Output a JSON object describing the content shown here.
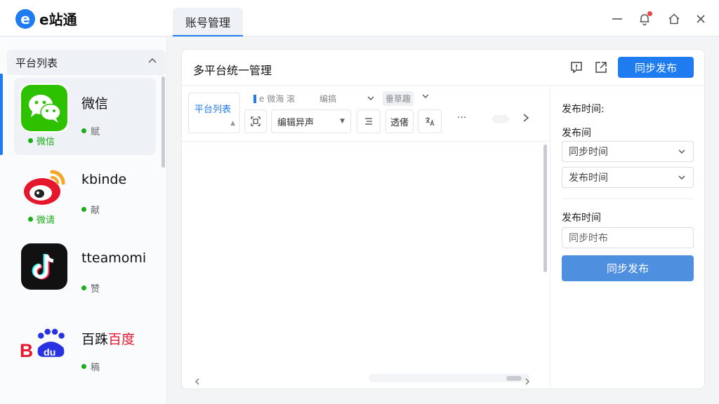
{
  "app": {
    "logo_letter": "e",
    "logo_text": "e站通"
  },
  "tabs": [
    {
      "label": "账号管理"
    }
  ],
  "sidebar": {
    "title": "平台列表",
    "platforms": [
      {
        "name": "微信",
        "status": "赋",
        "sub": "微信",
        "icon": "wechat-icon"
      },
      {
        "name": "kbinde",
        "status": "献",
        "sub": "微请",
        "icon": "weibo-icon"
      },
      {
        "name": "tteamomi",
        "status": "赞",
        "icon": "tiktok-icon"
      },
      {
        "name_prefix": "百跦",
        "name_brand": "百度",
        "status": "稿",
        "icon": "baidu-icon"
      }
    ]
  },
  "main": {
    "title": "多平台统一管理",
    "publish_label": "同步发布",
    "toolbar": {
      "platform_list": "平台列表",
      "blur_1": "e 微海 滚",
      "blur_2": "编搞",
      "blur_3": "垂草趣",
      "format_select": "编辑异声",
      "btn_1": "透偖",
      "more": "···"
    }
  },
  "right_panel": {
    "label_top": "发布时间:",
    "label_publish": "发布间",
    "select_1": "同步时间",
    "select_2": "发布时间",
    "label_time": "发布时间",
    "input_value": "同步时布",
    "button": "同步发布"
  },
  "colors": {
    "accent": "#1e7bf0",
    "wechat": "#1aad19",
    "weibo": "#e6162d",
    "baidu": "#2932e1"
  }
}
